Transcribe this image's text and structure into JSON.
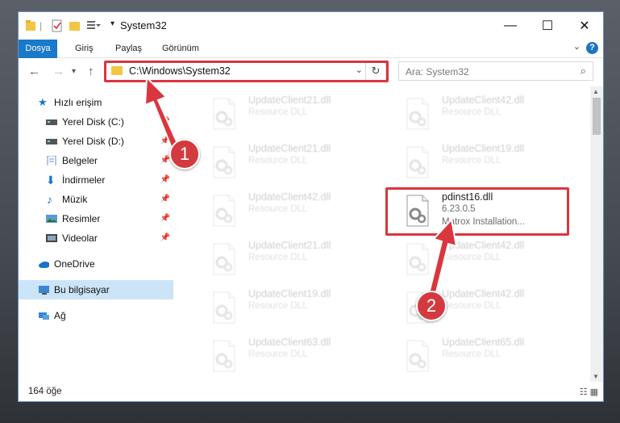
{
  "window": {
    "title": "System32"
  },
  "ribbon": {
    "tabs": [
      "Dosya",
      "Giriş",
      "Paylaş",
      "Görünüm"
    ],
    "help": "?"
  },
  "address": {
    "path": "C:\\Windows\\System32"
  },
  "search": {
    "placeholder": "Ara: System32"
  },
  "sidebar": {
    "items": [
      {
        "label": "Hızlı erişim",
        "icon": "star-icon"
      },
      {
        "label": "Yerel Disk (C:)",
        "icon": "drive-icon"
      },
      {
        "label": "Yerel Disk (D:)",
        "icon": "drive-icon"
      },
      {
        "label": "Belgeler",
        "icon": "documents-icon"
      },
      {
        "label": "İndirmeler",
        "icon": "download-icon"
      },
      {
        "label": "Müzik",
        "icon": "music-icon"
      },
      {
        "label": "Resimler",
        "icon": "pictures-icon"
      },
      {
        "label": "Videolar",
        "icon": "videos-icon"
      },
      {
        "label": "OneDrive",
        "icon": "cloud-icon"
      },
      {
        "label": "Bu bilgisayar",
        "icon": "computer-icon"
      },
      {
        "label": "Ağ",
        "icon": "network-icon"
      }
    ]
  },
  "files": [
    {
      "name": "UpdateClient21.dll",
      "desc": "Resource DLL",
      "highlight": false
    },
    {
      "name": "UpdateClient42.dll",
      "desc": "Resource DLL",
      "highlight": false
    },
    {
      "name": "UpdateClient21.dll",
      "desc": "Resource DLL",
      "highlight": false
    },
    {
      "name": "UpdateClient19.dll",
      "desc": "Resource DLL",
      "highlight": false
    },
    {
      "name": "UpdateClient42.dll",
      "desc": "Resource DLL",
      "highlight": false
    },
    {
      "name": "pdinst16.dll",
      "desc": "6.23.0.5",
      "desc2": "Matrox Installation...",
      "highlight": true
    },
    {
      "name": "UpdateClient21.dll",
      "desc": "Resource DLL",
      "highlight": false
    },
    {
      "name": "UpdateClient42.dll",
      "desc": "Resource DLL",
      "highlight": false
    },
    {
      "name": "UpdateClient19.dll",
      "desc": "Resource DLL",
      "highlight": false
    },
    {
      "name": "UpdateClient42.dll",
      "desc": "Resource DLL",
      "highlight": false
    },
    {
      "name": "UpdateClient63.dll",
      "desc": "Resource DLL",
      "highlight": false
    },
    {
      "name": "UpdateClient65.dll",
      "desc": "Resource DLL",
      "highlight": false
    }
  ],
  "status": {
    "count": "164 öğe"
  },
  "annotations": {
    "step1": "1",
    "step2": "2"
  },
  "colors": {
    "accent": "#1979ca",
    "annotation": "#d9363e"
  }
}
